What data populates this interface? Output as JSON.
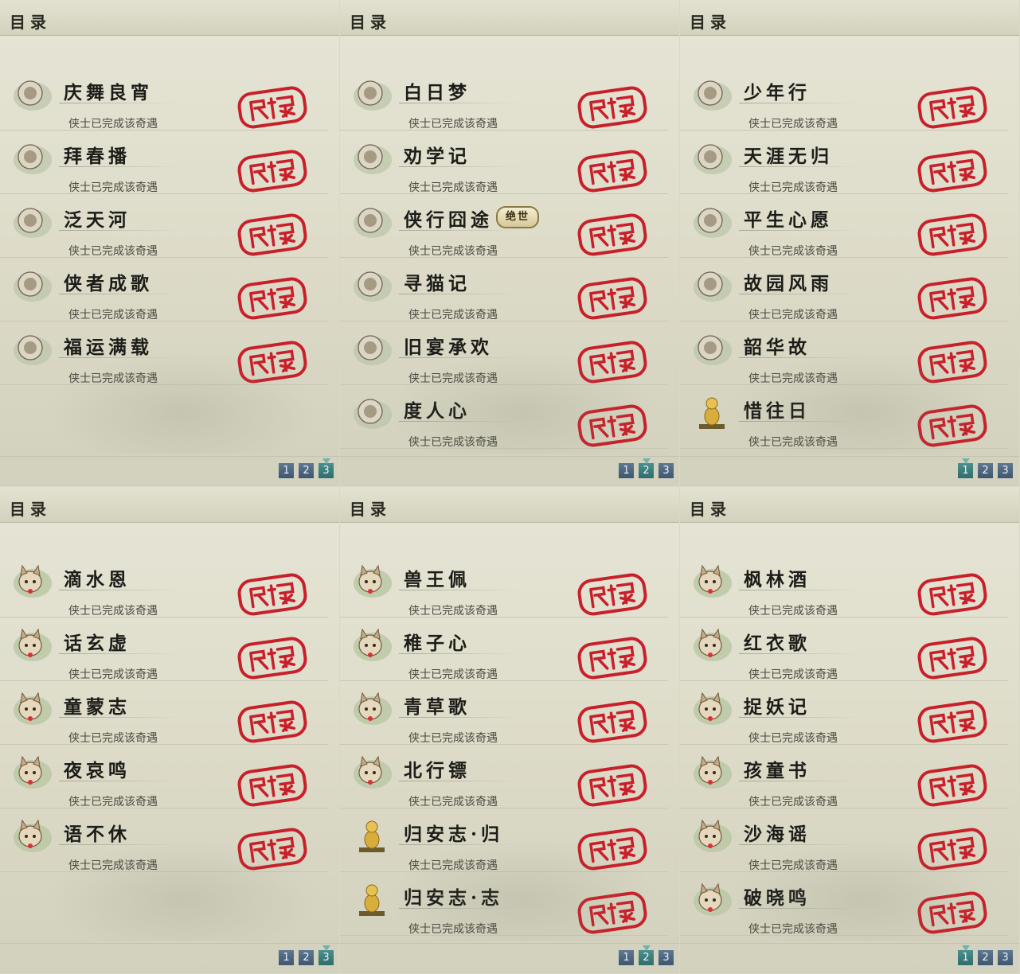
{
  "panels": [
    {
      "title": "目录",
      "entries": [
        {
          "name": "庆舞良宵",
          "status": "侠士已完成该奇遇",
          "icon": "lion-dance-icon"
        },
        {
          "name": "拜春播",
          "status": "侠士已完成该奇遇",
          "icon": "kangaroo-icon"
        },
        {
          "name": "泛天河",
          "status": "侠士已完成该奇遇",
          "icon": "green-lantern-icon"
        },
        {
          "name": "侠者成歌",
          "status": "侠士已完成该奇遇",
          "icon": "boat-icon"
        },
        {
          "name": "福运满载",
          "status": "侠士已完成该奇遇",
          "icon": "husky-dog-icon"
        }
      ],
      "pages": [
        "1",
        "2",
        "3"
      ],
      "active_page": 3
    },
    {
      "title": "目录",
      "entries": [
        {
          "name": "白日梦",
          "status": "侠士已完成该奇遇",
          "icon": "bed-icon"
        },
        {
          "name": "劝学记",
          "status": "侠士已完成该奇遇",
          "icon": "paw-icon"
        },
        {
          "name": "侠行囧途",
          "status": "侠士已完成该奇遇",
          "icon": "pavilion-icon",
          "badge": "绝世"
        },
        {
          "name": "寻猫记",
          "status": "侠士已完成该奇遇",
          "icon": "gray-cat-icon"
        },
        {
          "name": "旧宴承欢",
          "status": "侠士已完成该奇遇",
          "icon": "thumbs-up-icon"
        },
        {
          "name": "度人心",
          "status": "侠士已完成该奇遇",
          "icon": "mask-icon"
        }
      ],
      "pages": [
        "1",
        "2",
        "3"
      ],
      "active_page": 2
    },
    {
      "title": "目录",
      "entries": [
        {
          "name": "少年行",
          "status": "侠士已完成该奇遇",
          "icon": "straw-hat-icon"
        },
        {
          "name": "天涯无归",
          "status": "侠士已完成该奇遇",
          "icon": "shiba-dog-icon"
        },
        {
          "name": "平生心愿",
          "status": "侠士已完成该奇遇",
          "icon": "doll-icon"
        },
        {
          "name": "故园风雨",
          "status": "侠士已完成该奇遇",
          "icon": "fan-icon"
        },
        {
          "name": "韶华故",
          "status": "侠士已完成该奇遇",
          "icon": "jade-ornament-icon"
        },
        {
          "name": "惜往日",
          "status": "侠士已完成该奇遇",
          "icon": "gold-statue-icon"
        }
      ],
      "pages": [
        "1",
        "2",
        "3"
      ],
      "active_page": 1
    },
    {
      "title": "目录",
      "entries": [
        {
          "name": "滴水恩",
          "status": "侠士已完成该奇遇",
          "icon": "cat-face-icon"
        },
        {
          "name": "话玄虚",
          "status": "侠士已完成该奇遇",
          "icon": "cat-face-icon"
        },
        {
          "name": "童蒙志",
          "status": "侠士已完成该奇遇",
          "icon": "cat-face-icon"
        },
        {
          "name": "夜哀鸣",
          "status": "侠士已完成该奇遇",
          "icon": "cat-face-icon"
        },
        {
          "name": "语不休",
          "status": "侠士已完成该奇遇",
          "icon": "cat-face-icon"
        }
      ],
      "pages": [
        "1",
        "2",
        "3"
      ],
      "active_page": 3
    },
    {
      "title": "目录",
      "entries": [
        {
          "name": "兽王佩",
          "status": "侠士已完成该奇遇",
          "icon": "cat-face-icon"
        },
        {
          "name": "稚子心",
          "status": "侠士已完成该奇遇",
          "icon": "cat-face-icon"
        },
        {
          "name": "青草歌",
          "status": "侠士已完成该奇遇",
          "icon": "cat-face-icon"
        },
        {
          "name": "北行镖",
          "status": "侠士已完成该奇遇",
          "icon": "cat-face-icon"
        },
        {
          "name": "归安志·归",
          "status": "侠士已完成该奇遇",
          "icon": "gold-statue-icon"
        },
        {
          "name": "归安志·志",
          "status": "侠士已完成该奇遇",
          "icon": "gold-statue-icon"
        }
      ],
      "pages": [
        "1",
        "2",
        "3"
      ],
      "active_page": 2
    },
    {
      "title": "目录",
      "entries": [
        {
          "name": "枫林酒",
          "status": "侠士已完成该奇遇",
          "icon": "cat-face-icon"
        },
        {
          "name": "红衣歌",
          "status": "侠士已完成该奇遇",
          "icon": "cat-face-icon"
        },
        {
          "name": "捉妖记",
          "status": "侠士已完成该奇遇",
          "icon": "cat-face-icon"
        },
        {
          "name": "孩童书",
          "status": "侠士已完成该奇遇",
          "icon": "cat-face-icon"
        },
        {
          "name": "沙海谣",
          "status": "侠士已完成该奇遇",
          "icon": "cat-face-icon"
        },
        {
          "name": "破晓鸣",
          "status": "侠士已完成该奇遇",
          "icon": "cat-face-icon"
        }
      ],
      "pages": [
        "1",
        "2",
        "3"
      ],
      "active_page": 1
    }
  ],
  "colors": {
    "stamp_red": "#c8202a",
    "page_button": "#4a6480",
    "page_button_active": "#3a7e7d"
  }
}
